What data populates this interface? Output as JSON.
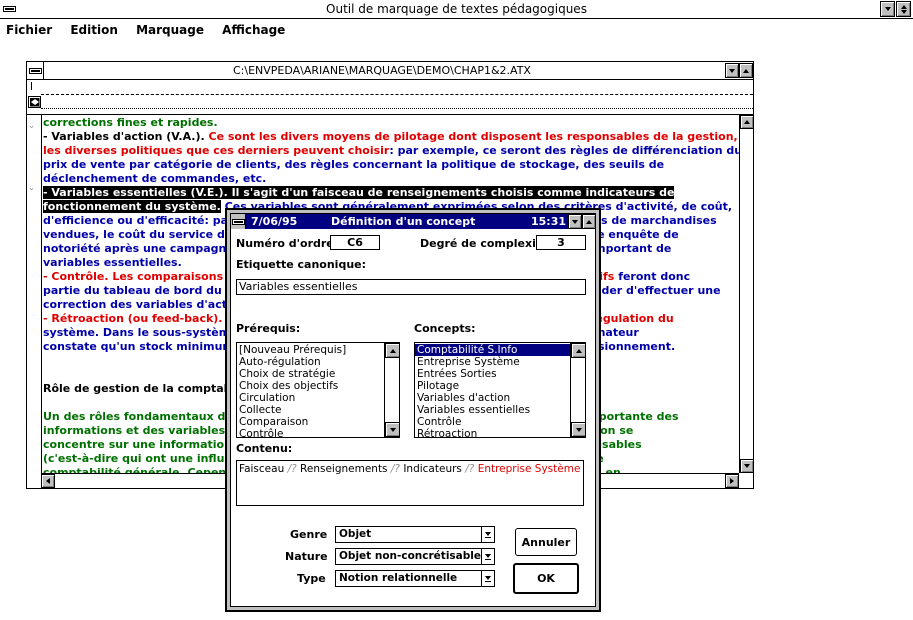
{
  "app": {
    "title": "Outil de marquage de textes pédagogiques",
    "menu": [
      "Fichier",
      "Edition",
      "Marquage",
      "Affichage"
    ]
  },
  "doc": {
    "path": "C:\\ENVPEDA\\ARIANE\\MARQUAGE\\DEMO\\CHAP1&2.ATX",
    "lines": [
      [
        {
          "t": "corrections fines et rapides.",
          "c": "green"
        }
      ],
      [
        {
          "t": "- Variables d'action (V.A.). ",
          "c": "black"
        },
        {
          "t": "Ce sont les divers moyens de pilotage dont disposent les responsables de la gestion,",
          "c": "red"
        }
      ],
      [
        {
          "t": "les diverses politiques que ces derniers peuvent choisir",
          "c": "red"
        },
        {
          "t": ": par exemple, ce seront des règles de différenciation du",
          "c": "blue"
        }
      ],
      [
        {
          "t": "prix de vente par catégorie de clients, des règles concernant la politique de stockage, des seuils de",
          "c": "blue"
        }
      ],
      [
        {
          "t": "déclenchement de commandes, etc.",
          "c": "blue"
        }
      ],
      [
        {
          "t": "- Variables essentielles (V.E.). Il s'agit d'un faisceau de renseignements choisis comme indicateurs de",
          "c": "hl"
        }
      ],
      [
        {
          "t": "fonctionnement du système.",
          "c": "hl"
        },
        {
          "t": " Ces variables sont généralement exprimées selon des critères d'activité, de coût,",
          "c": "blue"
        }
      ],
      [
        {
          "t": "d'efficience ou d'efficacité: par exemple, le chiffre d'affaires réalisé, le nombre et les types de marchandises",
          "c": "blue"
        }
      ],
      [
        {
          "t": "vendues, le coût du service d'entretien, le taux de satisfaction des clients mesuré par une enquête de",
          "c": "blue"
        }
      ],
      [
        {
          "t": "notoriété après une campagne publicitaire. Ces indicateurs se trouvent en nombre très important de",
          "c": "blue"
        }
      ],
      [
        {
          "t": "variables essentielles.",
          "c": "blue"
        }
      ],
      [
        {
          "t": "- Contrôle. Les comparaisons effectuées entre les objectifs et les résultats obtenus effectifs ",
          "c": "red"
        },
        {
          "t": "feront donc",
          "c": "blue"
        }
      ],
      [
        {
          "t": "partie du tableau de bord du dirigeant qui pourra alors, à partir de ces observations, décider d'effectuer une",
          "c": "blue"
        }
      ],
      [
        {
          "t": "correction des variables d'action.",
          "c": "blue"
        }
      ],
      [
        {
          "t": "- Rétroaction (ou feed-back). Cette rectification des écarts permet donc d'assurer l'autorégulation du",
          "c": "red"
        }
      ],
      [
        {
          "t": "système. Dans le sous-système de gestion des stocks, la rétroaction se fait lorsque l'ordinateur",
          "c": "blue"
        }
      ],
      [
        {
          "t": "constate qu'un stock minimum est atteint et qu'il déclenche une commande de réapprovisionnement.",
          "c": "blue"
        }
      ],
      [
        {
          "t": "",
          "c": "black"
        }
      ],
      [
        {
          "t": "",
          "c": "black"
        }
      ],
      [
        {
          "t": "Rôle de gestion de la comptabilité",
          "c": "black"
        }
      ],
      [
        {
          "t": "",
          "c": "black"
        }
      ],
      [
        {
          "t": "Un des rôles fondamentaux de la comptabilité est de fournir aux dirigeants une partie importante des",
          "c": "green"
        }
      ],
      [
        {
          "t": "informations et des variables essentielles nécessaires au pilotage de leur entreprise. Si l'on se",
          "c": "green"
        }
      ],
      [
        {
          "t": "concentre sur une information  pertinente, on peut sélectionner les indicateurs comptabilisables",
          "c": "green"
        }
      ],
      [
        {
          "t": "(c'est-à-dire qui ont une influence sur le résultat). Il faut donc, pour ce faire, rappeler une",
          "c": "green"
        }
      ],
      [
        {
          "t": "comptabilité générale. Cependant, la comptabilité analytique est aussi un système global en",
          "c": "green"
        }
      ]
    ]
  },
  "dialog": {
    "date": "7/06/95",
    "title": "Définition d'un concept",
    "time": "15:31",
    "numero_label": "Numéro d'ordre:",
    "numero_value": "C6",
    "degre_label": "Degré de complexité:",
    "degre_value": "3",
    "etiquette_label": "Etiquette canonique:",
    "etiquette_value": "Variables essentielles",
    "prerequis_label": "Prérequis:",
    "prerequis": [
      "[Nouveau Prérequis]",
      "Auto-régulation",
      "Choix de stratégie",
      "Choix des objectifs",
      "Circulation",
      "Collecte",
      "Comparaison",
      "Contrôle"
    ],
    "concepts_label": "Concepts:",
    "concepts": [
      "Comptabilité S.Info",
      "Entreprise Système",
      "Entrées Sorties",
      "Pilotage",
      "Variables d'action",
      "Variables essentielles",
      "Contrôle",
      "Rétroaction"
    ],
    "concepts_selected": 0,
    "contenu_label": "Contenu:",
    "contenu": [
      {
        "t": "Faisceau",
        "c": "black"
      },
      {
        "t": " /? ",
        "c": "grey"
      },
      {
        "t": "Renseignements",
        "c": "black"
      },
      {
        "t": " /? ",
        "c": "grey"
      },
      {
        "t": "Indicateurs",
        "c": "black"
      },
      {
        "t": " /? ",
        "c": "grey"
      },
      {
        "t": "Entreprise Système",
        "c": "red"
      }
    ],
    "genre_label": "Genre",
    "genre_value": "Objet",
    "nature_label": "Nature",
    "nature_value": "Objet non-concrétisable",
    "type_label": "Type",
    "type_value": "Notion relationnelle",
    "annuler": "Annuler",
    "ok": "OK"
  }
}
